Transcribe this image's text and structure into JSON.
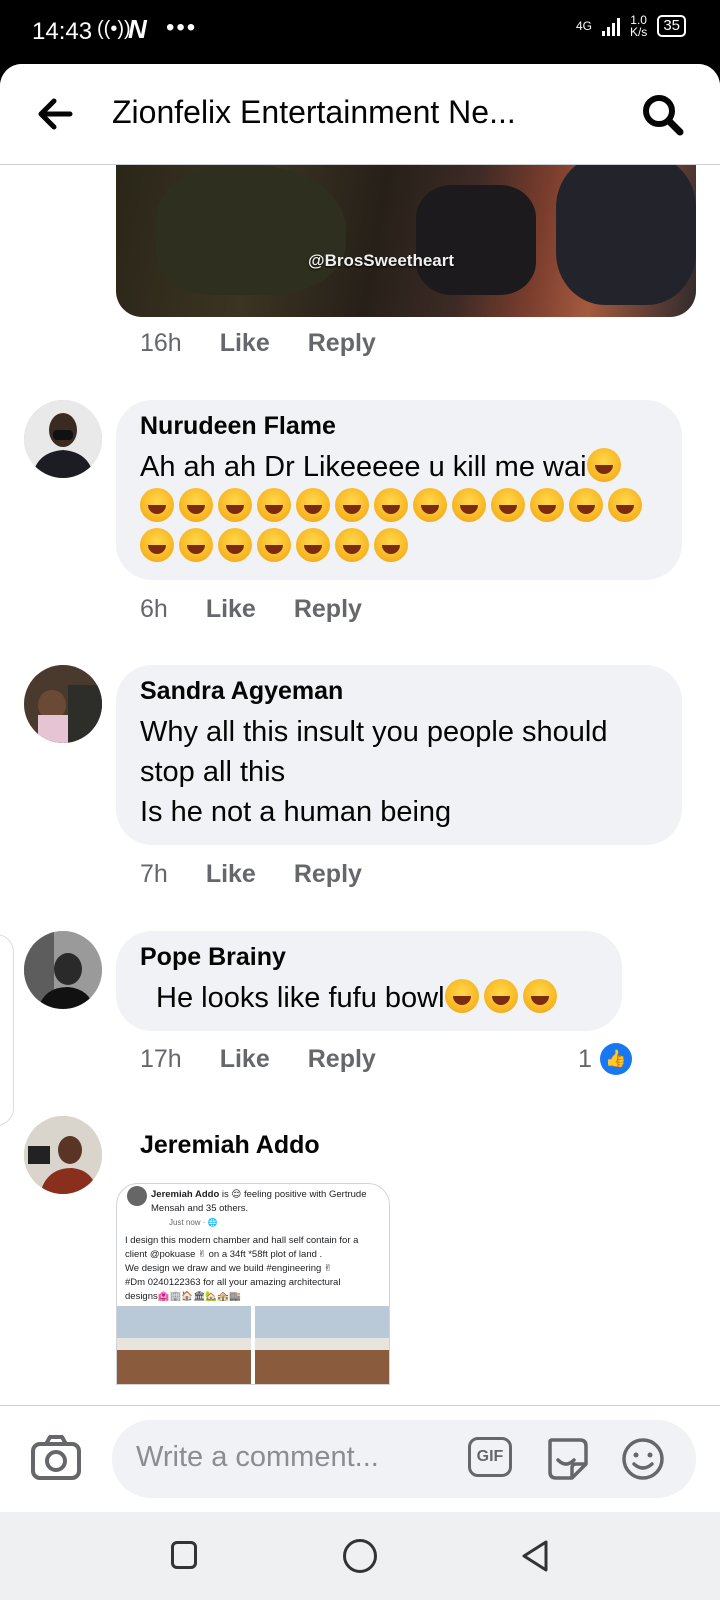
{
  "status_bar": {
    "time": "14:43",
    "icons_text": "((•))",
    "carrier_logo": "N",
    "more": "•••",
    "network": "4G",
    "speed_value": "1.0",
    "speed_unit": "K/s",
    "battery": "35"
  },
  "header": {
    "title": "Zionfelix Entertainment Ne..."
  },
  "photo": {
    "watermark": "@BrosSweetheart",
    "time": "16h",
    "like": "Like",
    "reply": "Reply"
  },
  "comments": [
    {
      "name": "Nurudeen Flame",
      "text": "Ah ah ah Dr Likeeeee u kill me wai",
      "emoji_count_line1": 1,
      "emoji_count_line2": 13,
      "emoji_count_line3": 7,
      "time": "6h",
      "like": "Like",
      "reply": "Reply"
    },
    {
      "name": "Sandra Agyeman",
      "text_line1": "Why all this insult you people should",
      "text_line2": "stop all this",
      "text_line3": "Is he not a human being",
      "time": "7h",
      "like": "Like",
      "reply": "Reply"
    },
    {
      "name": "Pope Brainy",
      "text": "He looks like fufu bowl",
      "emoji_count": 3,
      "time": "17h",
      "like": "Like",
      "reply": "Reply",
      "reactions": "1"
    },
    {
      "name": "Jeremiah Addo",
      "shared_post": {
        "header_name": "Jeremiah Addo",
        "header_rest": "is 😌 feeling positive with Gertrude Mensah and 35 others.",
        "sub": "Just now · 🌐",
        "body_line1": "I design this modern chamber and hall self contain for a",
        "body_line2": "client @pokuase ✌ on a 34ft *58ft plot of land .",
        "body_line3": "We design we draw and we build #engineering ✌",
        "body_line4": "#Dm  0240122363 for all your amazing architectural",
        "body_line5": "designs🏩🏢🏠🏛🏡🏤🏬"
      }
    }
  ],
  "composer": {
    "placeholder": "Write a comment...",
    "gif_label": "GIF"
  },
  "icons": {
    "back": "arrow-left-icon",
    "search": "search-icon",
    "camera": "camera-icon",
    "sticker": "sticker-icon",
    "emoji": "smile-icon",
    "like": "thumbs-up-icon"
  },
  "colors": {
    "accent": "#1877f2",
    "bubble": "#f0f2f5",
    "meta": "#65676b"
  }
}
